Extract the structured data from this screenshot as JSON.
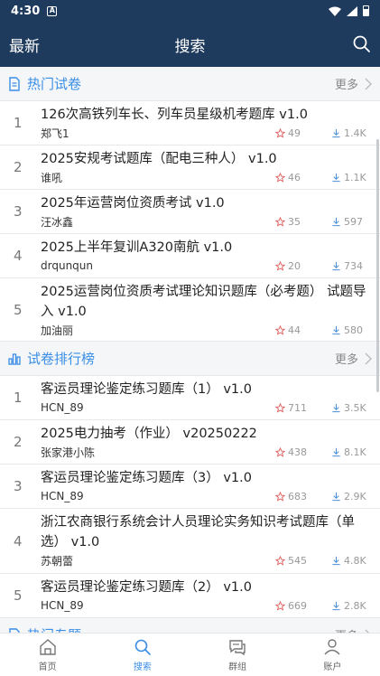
{
  "status": {
    "time": "4:30",
    "a_glyph": "A"
  },
  "appbar": {
    "left_title": "最新",
    "center_title": "搜索"
  },
  "sections": [
    {
      "title": "热门试卷",
      "more": "更多",
      "items": [
        {
          "rank": "1",
          "title": "126次高铁列车长、列车员星级机考题库 v1.0",
          "author": "郑飞1",
          "stars": "49",
          "downloads": "1.4K"
        },
        {
          "rank": "2",
          "title": "2025安规考试题库（配电三种人） v1.0",
          "author": "谁吼",
          "stars": "46",
          "downloads": "1.1K"
        },
        {
          "rank": "3",
          "title": "2025年运营岗位资质考试 v1.0",
          "author": "汪冰鑫",
          "stars": "35",
          "downloads": "597"
        },
        {
          "rank": "4",
          "title": "2025上半年复训A320南航 v1.0",
          "author": "drqunqun",
          "stars": "20",
          "downloads": "734"
        },
        {
          "rank": "5",
          "title": "2025运营岗位资质考试理论知识题库（必考题） 试题导入 v1.0",
          "author": "加油丽",
          "stars": "44",
          "downloads": "580"
        }
      ]
    },
    {
      "title": "试卷排行榜",
      "more": "更多",
      "items": [
        {
          "rank": "1",
          "title": "客运员理论鉴定练习题库（1） v1.0",
          "author": "HCN_89",
          "stars": "711",
          "downloads": "3.5K"
        },
        {
          "rank": "2",
          "title": "2025电力抽考（作业） v20250222",
          "author": "张家港小陈",
          "stars": "438",
          "downloads": "8.1K"
        },
        {
          "rank": "3",
          "title": "客运员理论鉴定练习题库（3） v1.0",
          "author": "HCN_89",
          "stars": "683",
          "downloads": "2.9K"
        },
        {
          "rank": "4",
          "title": "浙江农商银行系统会计人员理论实务知识考试题库（单选） v1.0",
          "author": "苏朝蕾",
          "stars": "545",
          "downloads": "4.8K"
        },
        {
          "rank": "5",
          "title": "客运员理论鉴定练习题库（2） v1.0",
          "author": "HCN_89",
          "stars": "669",
          "downloads": "2.8K"
        }
      ]
    },
    {
      "title": "热门专题",
      "more": "更多",
      "items": []
    }
  ],
  "tabs": [
    {
      "label": "首页",
      "icon": "home-icon"
    },
    {
      "label": "搜索",
      "icon": "search-icon"
    },
    {
      "label": "群组",
      "icon": "group-icon"
    },
    {
      "label": "账户",
      "icon": "user-icon"
    }
  ],
  "colors": {
    "primary": "#1e3a5c",
    "accent": "#3a8ee6",
    "star": "#e05a5a",
    "download": "#4a8fd6"
  }
}
